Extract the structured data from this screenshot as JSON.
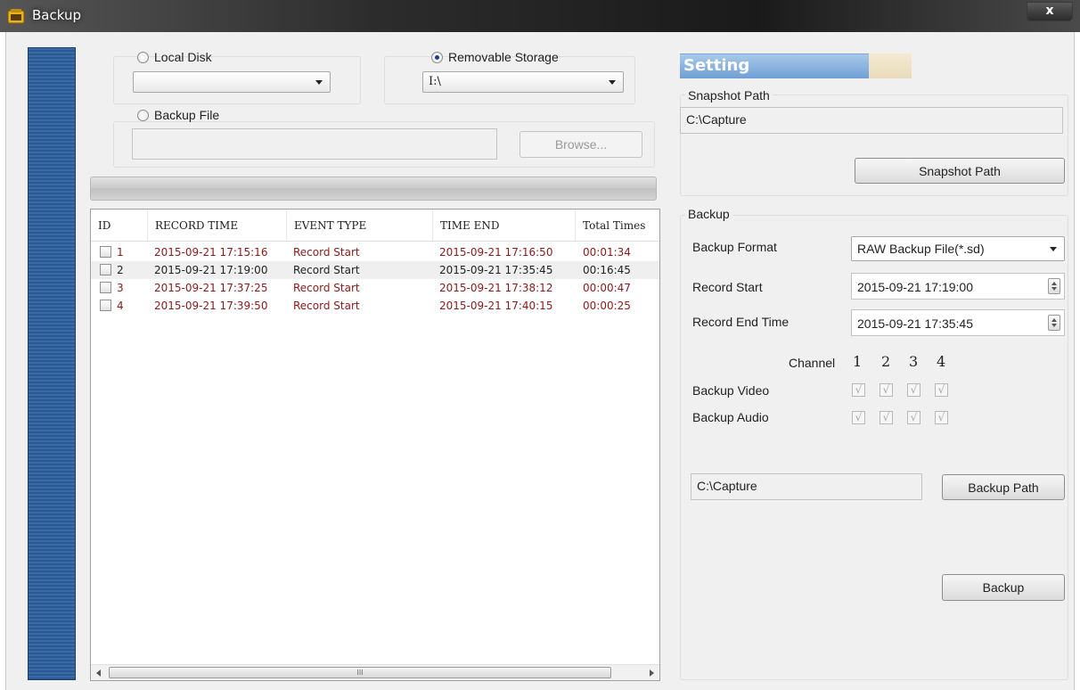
{
  "window": {
    "title": "Backup",
    "close_glyph": "x",
    "icon": "app-icon"
  },
  "source": {
    "local_disk": {
      "label": "Local Disk",
      "checked": false,
      "value": ""
    },
    "removable_storage": {
      "label": "Removable Storage",
      "checked": true,
      "value": "I:\\"
    },
    "backup_file": {
      "label": "Backup File",
      "checked": false,
      "value": ""
    },
    "browse_label": "Browse..."
  },
  "records": {
    "columns": [
      "ID",
      "RECORD TIME",
      "EVENT TYPE",
      "TIME END",
      "Total Times"
    ],
    "rows": [
      {
        "id": "1",
        "record_time": "2015-09-21 17:15:16",
        "event_type": "Record Start",
        "time_end": "2015-09-21 17:16:50",
        "total": "00:01:34",
        "color": "#8b1a1a"
      },
      {
        "id": "2",
        "record_time": "2015-09-21 17:19:00",
        "event_type": "Record Start",
        "time_end": "2015-09-21 17:35:45",
        "total": "00:16:45",
        "color": "#222222"
      },
      {
        "id": "3",
        "record_time": "2015-09-21 17:37:25",
        "event_type": "Record Start",
        "time_end": "2015-09-21 17:38:12",
        "total": "00:00:47",
        "color": "#8b1a1a"
      },
      {
        "id": "4",
        "record_time": "2015-09-21 17:39:50",
        "event_type": "Record Start",
        "time_end": "2015-09-21 17:40:15",
        "total": "00:00:25",
        "color": "#8b1a1a"
      }
    ],
    "scroll_thumb_glyph": "III"
  },
  "setting": {
    "title": "Setting",
    "snapshot": {
      "group_label": "Snapshot Path",
      "path": "C:\\Capture",
      "button_label": "Snapshot Path"
    },
    "backup": {
      "group_label": "Backup",
      "format_label": "Backup Format",
      "format_value": "RAW Backup File(*.sd)",
      "record_start_label": "Record Start",
      "record_start_value": "2015-09-21 17:19:00",
      "record_end_label": "Record End Time",
      "record_end_value": "2015-09-21 17:35:45",
      "channel_label": "Channel",
      "channels": [
        "1",
        "2",
        "3",
        "4"
      ],
      "video_label": "Backup Video",
      "audio_label": "Backup Audio",
      "check_glyph": "√",
      "path_value": "C:\\Capture",
      "path_button": "Backup Path",
      "backup_button": "Backup"
    }
  },
  "colors": {
    "accent": "#6f9fd4",
    "row_red": "#8b1a1a",
    "side_strip": "#2b5a93"
  }
}
